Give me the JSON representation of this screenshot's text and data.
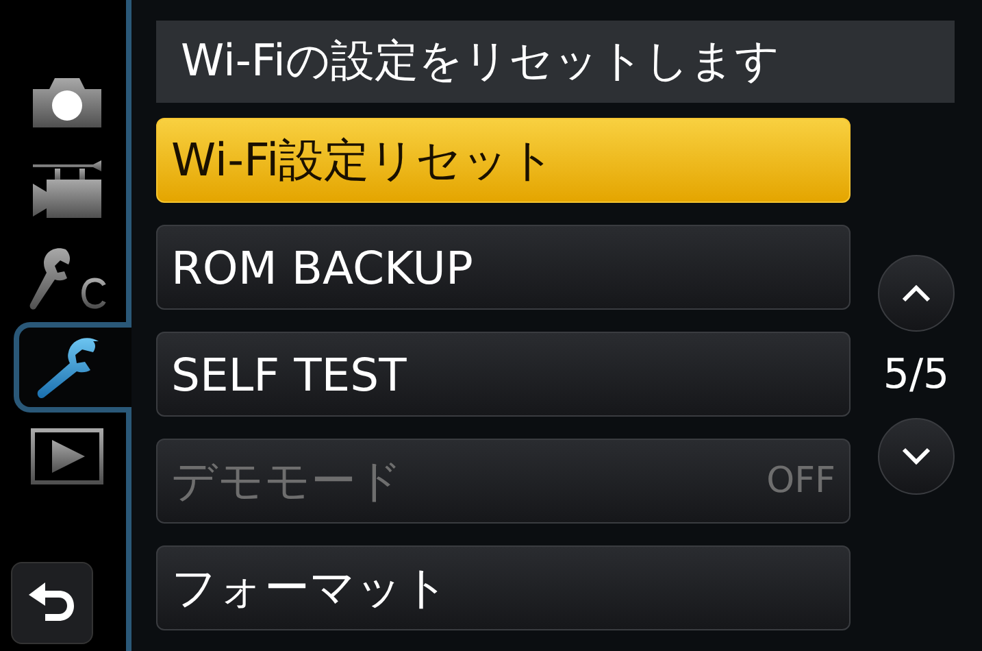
{
  "sidebar": {
    "tabs": [
      {
        "kind": "camera",
        "selected": false
      },
      {
        "kind": "movie",
        "selected": false
      },
      {
        "kind": "custom",
        "selected": false
      },
      {
        "kind": "setup",
        "selected": true
      },
      {
        "kind": "playback",
        "selected": false
      }
    ]
  },
  "header": {
    "text": "Wi-Fiの設定をリセットします"
  },
  "menu_items": [
    {
      "label": "Wi-Fi設定リセット",
      "selected": true,
      "disabled": false
    },
    {
      "label": "ROM BACKUP",
      "selected": false,
      "disabled": false
    },
    {
      "label": "SELF TEST",
      "selected": false,
      "disabled": false
    },
    {
      "label": "デモモード",
      "selected": false,
      "disabled": true,
      "value": "OFF"
    },
    {
      "label": "フォーマット",
      "selected": false,
      "disabled": false
    }
  ],
  "pager": {
    "page": "5/5"
  }
}
